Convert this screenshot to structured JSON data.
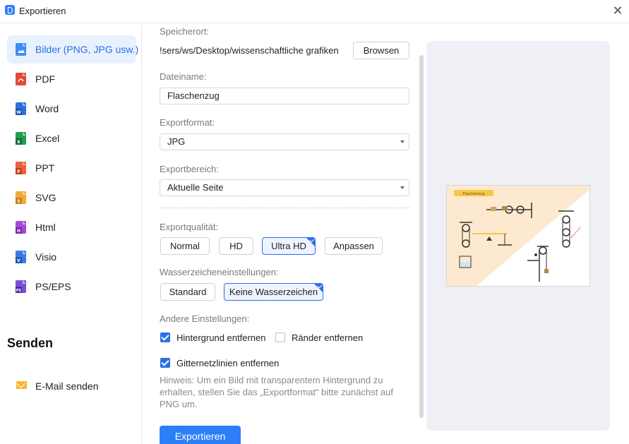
{
  "window": {
    "title": "Exportieren"
  },
  "sidebar": {
    "items": [
      {
        "label": "Bilder (PNG, JPG usw.)",
        "icon": "image-file-icon",
        "color": "#3a8ef6",
        "active": true
      },
      {
        "label": "PDF",
        "icon": "pdf-file-icon",
        "color": "#e5493a"
      },
      {
        "label": "Word",
        "icon": "word-file-icon",
        "color": "#2b6fe0"
      },
      {
        "label": "Excel",
        "icon": "excel-file-icon",
        "color": "#1f9d55"
      },
      {
        "label": "PPT",
        "icon": "ppt-file-icon",
        "color": "#f0613a"
      },
      {
        "label": "SVG",
        "icon": "svg-file-icon",
        "color": "#f2a93b"
      },
      {
        "label": "Html",
        "icon": "html-file-icon",
        "color": "#a64ad9"
      },
      {
        "label": "Visio",
        "icon": "visio-file-icon",
        "color": "#3b7be8"
      },
      {
        "label": "PS/EPS",
        "icon": "pseps-file-icon",
        "color": "#7a4fd9"
      }
    ],
    "send_heading": "Senden",
    "send_items": [
      {
        "label": "E-Mail senden",
        "icon": "mail-icon"
      }
    ]
  },
  "form": {
    "location_label": "Speicherort:",
    "location_value": "!sers/ws/Desktop/wissenschaftliche grafiken",
    "browse_label": "Browsen",
    "filename_label": "Dateiname:",
    "filename_value": "Flaschenzug",
    "format_label": "Exportformat:",
    "format_value": "JPG",
    "range_label": "Exportbereich:",
    "range_value": "Aktuelle Seite",
    "quality_label": "Exportqualität:",
    "quality_options": [
      "Normal",
      "HD",
      "Ultra HD",
      "Anpassen"
    ],
    "quality_selected": "Ultra HD",
    "watermark_label": "Wasserzeicheneinstellungen:",
    "watermark_options": [
      "Standard",
      "Keine Wasserzeichen"
    ],
    "watermark_selected": "Keine Wasserzeichen",
    "other_label": "Andere Einstellungen:",
    "checkboxes": [
      {
        "label": "Hintergrund entfernen",
        "checked": true
      },
      {
        "label": "Ränder entfernen",
        "checked": false
      },
      {
        "label": "Gitternetzlinien entfernen",
        "checked": true
      }
    ],
    "hint": "Hinweis: Um ein Bild mit transparentem Hintergrund zu erhalten, stellen Sie das „Exportformat“ bitte zunächst auf PNG um.",
    "export_label": "Exportieren"
  },
  "preview": {
    "caption": "Flaschenzug"
  },
  "colors": {
    "accent": "#2d7ff9",
    "active_bg": "#e8f1fe",
    "preview_bg": "#eef0f5",
    "preview_triangle": "#fde9cf"
  }
}
